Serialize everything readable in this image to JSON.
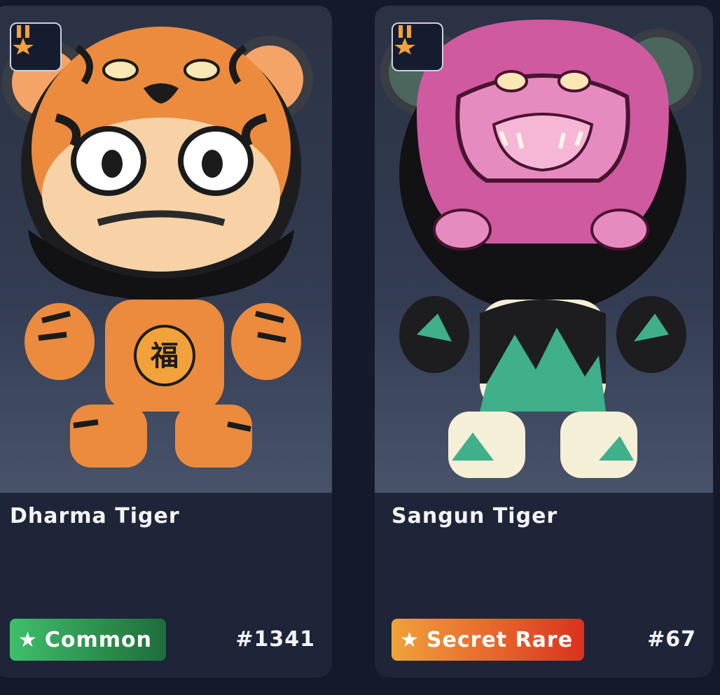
{
  "cards": [
    {
      "name": "Dharma Tiger",
      "rarity": "Common",
      "number": "#1341",
      "rarity_color": "#2e9150",
      "badge_icon": "medal-icon",
      "figure_icon": "dharma-tiger-figure",
      "character": "福"
    },
    {
      "name": "Sangun Tiger",
      "rarity": "Secret Rare",
      "number": "#67",
      "rarity_color": "#e3502a",
      "badge_icon": "medal-icon",
      "figure_icon": "sangun-tiger-figure"
    }
  ],
  "colors": {
    "background": "#141a2b",
    "card": "#1f2538",
    "medal_gold": "#f2a23a"
  }
}
